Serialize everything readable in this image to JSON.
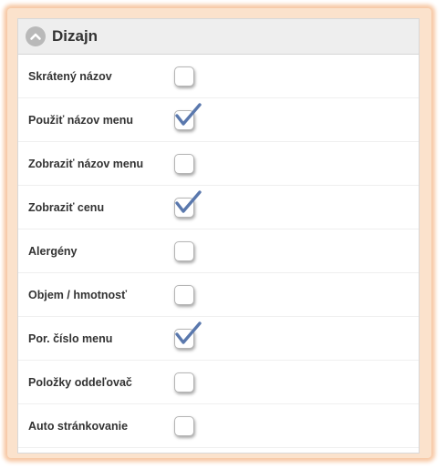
{
  "panel": {
    "title": "Dizajn",
    "collapse_icon": "chevron-up-icon"
  },
  "colors": {
    "frame_glow": "#f7c7a3",
    "checkmark": "#5a78ad"
  },
  "options": [
    {
      "label": "Skrátený názov",
      "checked": false
    },
    {
      "label": "Použiť názov menu",
      "checked": true
    },
    {
      "label": "Zobraziť názov menu",
      "checked": false
    },
    {
      "label": "Zobraziť cenu",
      "checked": true
    },
    {
      "label": "Alergény",
      "checked": false
    },
    {
      "label": "Objem / hmotnosť",
      "checked": false
    },
    {
      "label": "Por. číslo menu",
      "checked": true
    },
    {
      "label": "Položky oddeľovač",
      "checked": false
    },
    {
      "label": "Auto stránkovanie",
      "checked": false
    }
  ]
}
